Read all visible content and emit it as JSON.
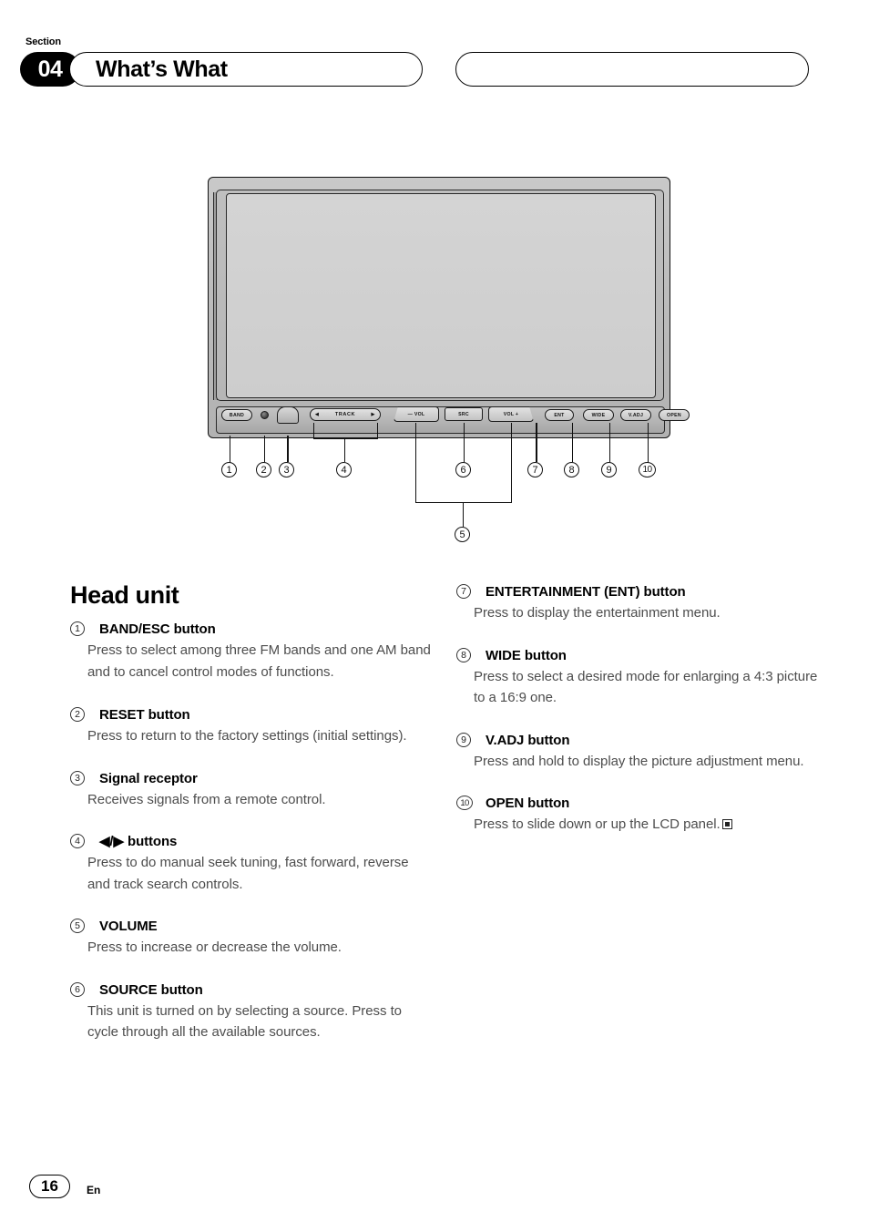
{
  "header": {
    "section_label": "Section",
    "section_number": "04",
    "title": "What’s What",
    "right_pill": ""
  },
  "figure": {
    "caption": "",
    "device_buttons": [
      {
        "id": "band",
        "label": "BAND"
      },
      {
        "id": "reset",
        "label": ""
      },
      {
        "id": "receptor",
        "label": ""
      },
      {
        "id": "track",
        "label": "TRACK",
        "arrow_left": "◀",
        "arrow_right": "▶"
      },
      {
        "id": "vol-minus",
        "label": "— VOL"
      },
      {
        "id": "src",
        "label": "SRC"
      },
      {
        "id": "vol-plus",
        "label": "VOL +"
      },
      {
        "id": "ent",
        "label": "ENT"
      },
      {
        "id": "wide",
        "label": "WIDE"
      },
      {
        "id": "vadj",
        "label": "V.ADJ"
      },
      {
        "id": "open",
        "label": "OPEN"
      }
    ],
    "callouts": [
      "1",
      "2",
      "3",
      "4",
      "5",
      "6",
      "7",
      "8",
      "9",
      "10"
    ]
  },
  "main": {
    "heading": "Head unit",
    "left_entries": [
      {
        "num": "1",
        "title": "BAND/ESC button",
        "body": "Press to select among three FM bands and one AM band and to cancel control modes of functions."
      },
      {
        "num": "2",
        "title": "RESET button",
        "body": "Press to return to the factory settings (initial settings)."
      },
      {
        "num": "3",
        "title": "Signal receptor",
        "body": "Receives signals from a remote control."
      },
      {
        "num": "4",
        "title": "◀/▶ buttons",
        "body": "Press to do manual seek tuning, fast forward, reverse and track search controls."
      },
      {
        "num": "5",
        "title": "VOLUME",
        "body": "Press to increase or decrease the volume."
      },
      {
        "num": "6",
        "title": "SOURCE button",
        "body": "This unit is turned on by selecting a source. Press to cycle through all the available sources."
      }
    ],
    "right_entries": [
      {
        "num": "7",
        "title": "ENTERTAINMENT (ENT) button",
        "body": "Press to display the entertainment menu."
      },
      {
        "num": "8",
        "title": "WIDE button",
        "body": "Press to select a desired mode for enlarging a 4:3 picture to a 16:9 one."
      },
      {
        "num": "9",
        "title": "V.ADJ button",
        "body": "Press and hold to display the picture adjustment menu."
      },
      {
        "num": "10",
        "title": "OPEN button",
        "body": "Press to slide down or up the LCD panel.",
        "end_marker": true
      }
    ]
  },
  "footer": {
    "page_number": "16",
    "language": "En"
  }
}
